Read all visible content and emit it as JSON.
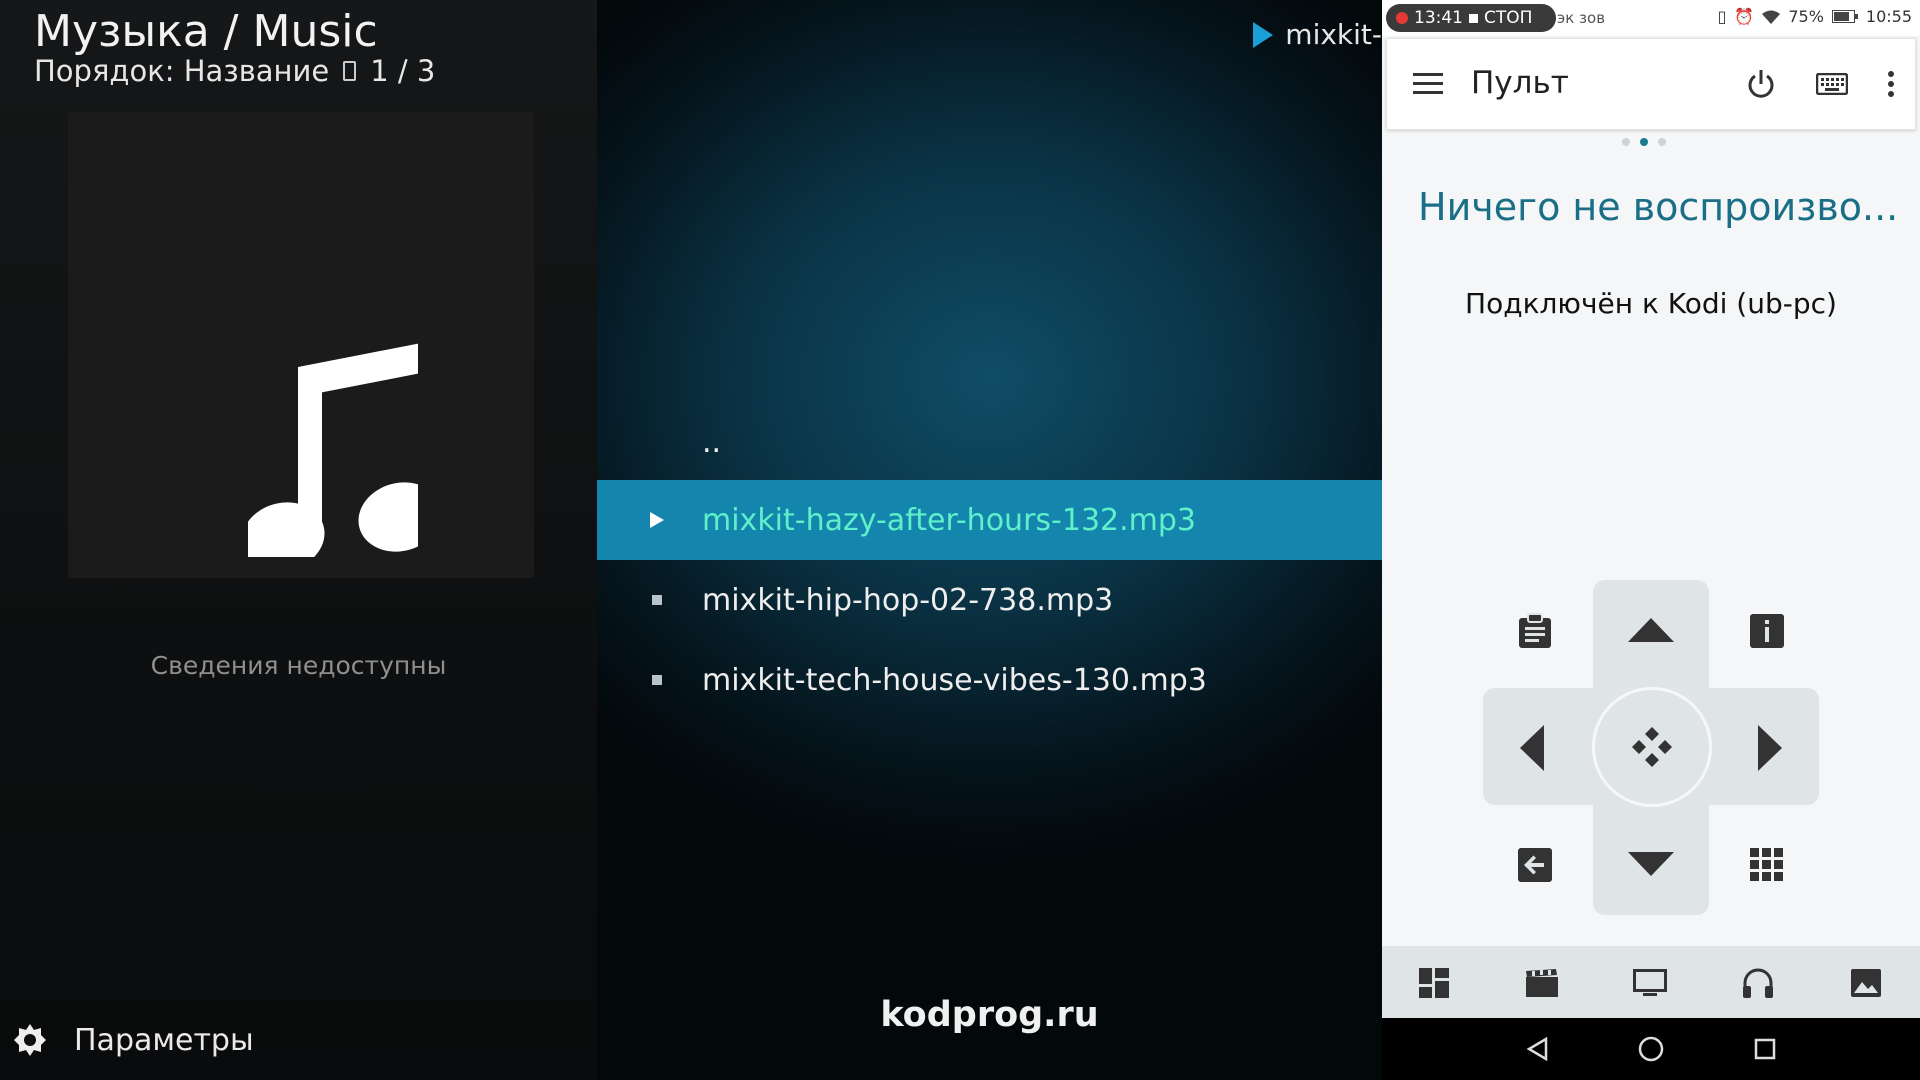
{
  "kodi": {
    "breadcrumb": "Музыка / Music",
    "sort_label": "Порядок: Название",
    "sort_count": "1 / 3",
    "no_info": "Сведения недоступны",
    "params_label": "Параметры",
    "now_playing": "mixkit-",
    "list": {
      "parent": "..",
      "items": [
        "mixkit-hazy-after-hours-132.mp3",
        "mixkit-hip-hop-02-738.mp3",
        "mixkit-tech-house-vibes-130.mp3"
      ]
    },
    "watermark": "kodprog.ru",
    "colors": {
      "selection": "#1486ad",
      "selected_text": "#5ff0ca",
      "accent": "#1a9fd6"
    }
  },
  "phone": {
    "status": {
      "rec_time": "13:41",
      "rec_stop": "СТОП",
      "partial_text": "эк   зов",
      "battery": "75%",
      "clock": "10:55"
    },
    "title": "Пульт",
    "nothing_playing": "Ничего не воспроизво...",
    "connected": "Подключён к Kodi (ub-pc)",
    "page_dots": {
      "count": 3,
      "active": 1
    },
    "icons": {
      "menu": "hamburger-icon",
      "power": "power-icon",
      "keyboard": "keyboard-icon",
      "more": "more-vert-icon",
      "dpad_center": "select-icon",
      "context": "clipboard-icon",
      "info": "info-icon",
      "back": "back-arrow-icon",
      "numpad": "grid-icon"
    },
    "tabs": [
      "dashboard-icon",
      "movies-icon",
      "tv-icon",
      "music-icon",
      "pictures-icon"
    ],
    "colors": {
      "accent": "#1a6f86",
      "dpad": "#dfe4e6"
    }
  }
}
